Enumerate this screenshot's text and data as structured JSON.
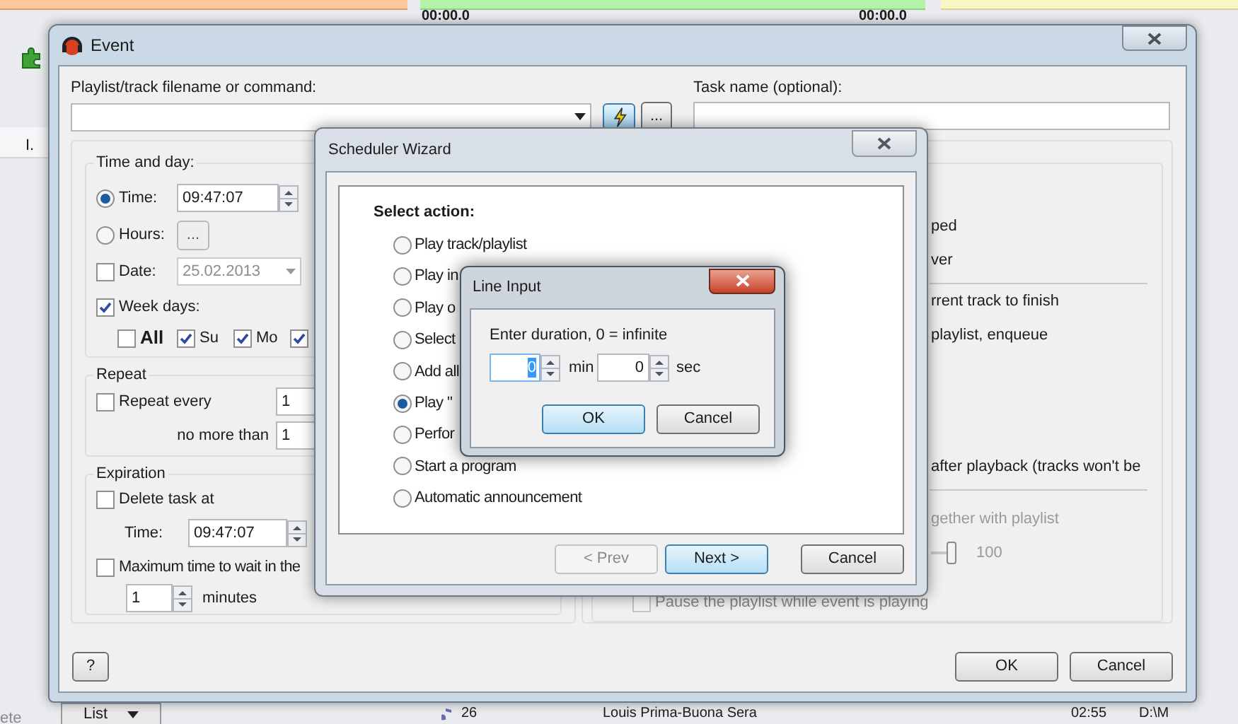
{
  "background_app": {
    "timers": [
      "00:00.0",
      "00:00.0"
    ],
    "column_header": "I.",
    "left_cut_text": "ete",
    "view_button": "List",
    "track_row": {
      "number": "26",
      "title": "Louis Prima-Buona Sera",
      "duration": "02:55",
      "path": "D:\\M"
    }
  },
  "event_window": {
    "title": "Event",
    "command_label": "Playlist/track filename or command:",
    "more_button": "...",
    "task_label": "Task name (optional):",
    "time_and_day": {
      "title": "Time and day:",
      "time": {
        "label": "Time:",
        "selected": true,
        "value": "09:47:07"
      },
      "hours": {
        "label": "Hours:",
        "selected": false,
        "button": "..."
      },
      "date": {
        "label": "Date:",
        "checked": false,
        "value": "25.02.2013"
      },
      "week_days": {
        "label": "Week days:",
        "checked": true
      },
      "days": [
        {
          "label": "All",
          "checked": false
        },
        {
          "label": "Su",
          "checked": true
        },
        {
          "label": "Mo",
          "checked": true
        },
        {
          "checked": true
        }
      ]
    },
    "repeat": {
      "title": "Repeat",
      "repeat_every": {
        "label": "Repeat every",
        "checked": false,
        "value": "1"
      },
      "no_more_than": {
        "label": "no more than",
        "value": "1"
      }
    },
    "expiration": {
      "title": "Expiration",
      "delete_task": {
        "label": "Delete task at",
        "checked": false
      },
      "time_label": "Time:",
      "time_value": "09:47:07",
      "max_wait": {
        "label": "Maximum time to wait in the",
        "checked": false
      },
      "minutes_value": "1",
      "minutes_label": "minutes"
    },
    "option_lines": [
      {
        "text": "ped",
        "disabled": false,
        "divider_after": false
      },
      {
        "text": "ver",
        "disabled": false,
        "divider_after": true
      },
      {
        "text": "rrent track to finish",
        "disabled": false,
        "divider_after": false
      },
      {
        "text": "playlist, enqueue",
        "disabled": false,
        "divider_after": false
      },
      {
        "text": "after playback (tracks won't be",
        "disabled": false,
        "divider_after": true
      },
      {
        "text": "gether with playlist",
        "disabled": true,
        "divider_after": false
      }
    ],
    "volume": {
      "level": 1,
      "reading": "100"
    },
    "pause_option": {
      "label": "Pause the playlist while event is playing",
      "checked": false,
      "disabled": true
    },
    "help_button": "?",
    "ok_button": "OK",
    "cancel_button": "Cancel"
  },
  "scheduler_wizard": {
    "title": "Scheduler Wizard",
    "heading": "Select action:",
    "actions": [
      {
        "label": "Play track/playlist",
        "selected": false
      },
      {
        "label": "Play in",
        "selected": false
      },
      {
        "label": "Play o",
        "selected": false
      },
      {
        "label": "Select",
        "selected": false
      },
      {
        "label": "Add all",
        "selected": false
      },
      {
        "label": "Play \"",
        "selected": true
      },
      {
        "label": "Perfor",
        "selected": false
      },
      {
        "label": "Start a program",
        "selected": false
      },
      {
        "label": "Automatic announcement",
        "selected": false
      }
    ],
    "prev_button": {
      "label": "< Prev",
      "disabled": true
    },
    "next_button": "Next >",
    "cancel_button": "Cancel"
  },
  "line_input": {
    "title": "Line Input",
    "prompt": "Enter duration, 0 = infinite",
    "minutes_value": "0",
    "minutes_label": "min",
    "seconds_value": "0",
    "seconds_label": "sec",
    "ok_button": "OK",
    "cancel_button": "Cancel"
  }
}
